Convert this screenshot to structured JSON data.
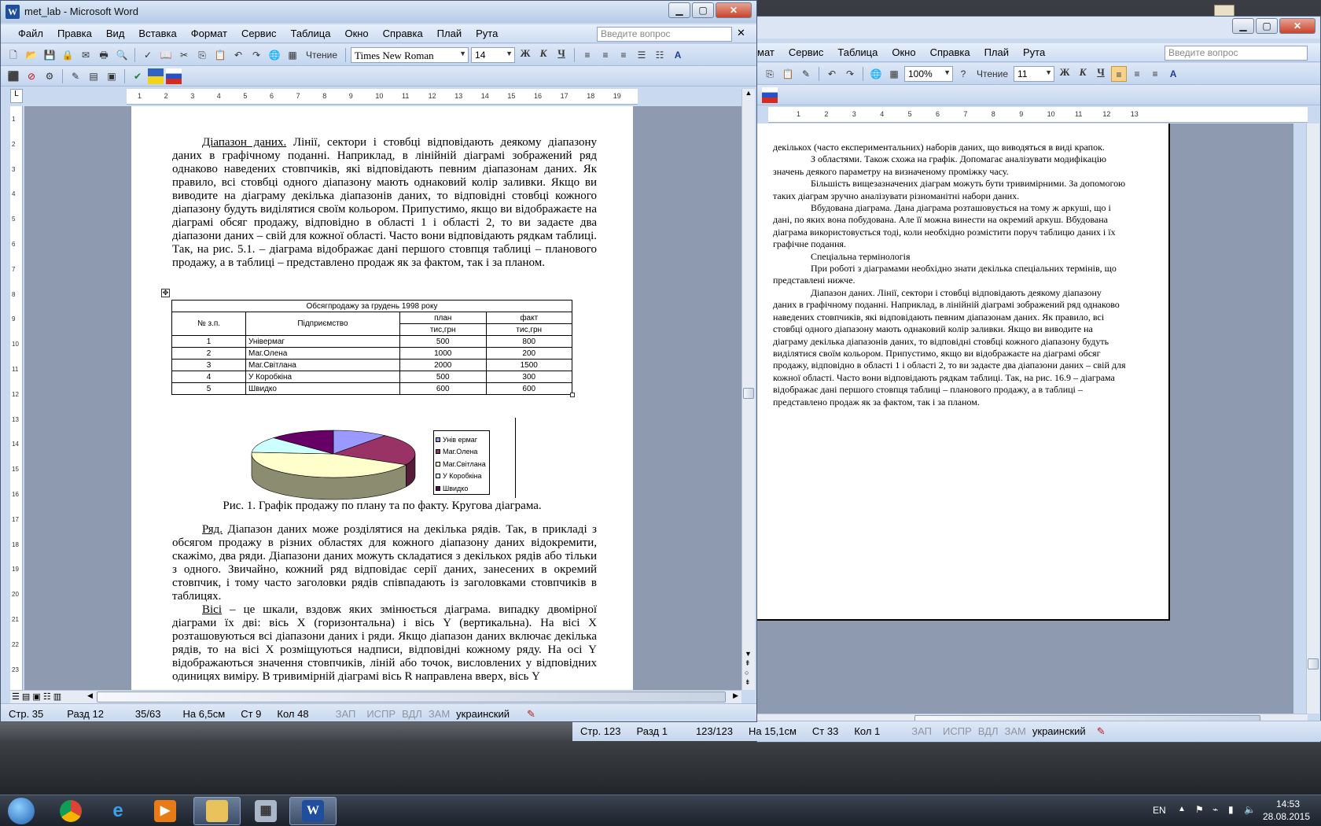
{
  "win1": {
    "title": "met_lab - Microsoft Word",
    "menu": [
      "Файл",
      "Правка",
      "Вид",
      "Вставка",
      "Формат",
      "Сервис",
      "Таблица",
      "Окно",
      "Справка",
      "Плай",
      "Рута"
    ],
    "ask_placeholder": "Введите вопрос",
    "reading_label": "Чтение",
    "font": "Times New Roman",
    "size": "14",
    "fmt": {
      "bold": "Ж",
      "italic": "К",
      "underline": "Ч"
    },
    "ruler_marks": [
      "1",
      "2",
      "3",
      "4",
      "5",
      "6",
      "7",
      "8",
      "9",
      "10",
      "11",
      "12",
      "13",
      "14",
      "15",
      "16",
      "17",
      "18",
      "19"
    ],
    "vruler_marks": [
      "1",
      "2",
      "3",
      "4",
      "5",
      "6",
      "7",
      "8",
      "9",
      "10",
      "11",
      "12",
      "13",
      "14",
      "15",
      "16",
      "17",
      "18",
      "19",
      "20",
      "21",
      "22",
      "23"
    ],
    "para1_head": "Діапазон даних.",
    "para1": " Лінії, сектори і стовбці відповідають деякому діапазону даних в графічному поданні. Наприклад, в лінійній діаграмі зображений ряд однаково наведених стовпчиків, які відповідають певним діапазонам даних. Як правило, всі стовбці одного діапазону мають однаковий колір заливки. Якщо ви виводите на діаграму декілька діапазонів даних, то відповідні стовбці кожного діапазону будуть виділятися своїм кольором. Припустимо, якщо ви відображаєте на діаграмі обсяг продажу, відповідно в області 1 і області 2, то ви задаєте два діапазони даних – свій для кожної області. Часто вони відповідають рядкам таблиці. Так, на рис. 5.1. – діаграма відображає дані першого стовпця таблиці – планового продажу, а в таблиці – представлено продаж як за фактом, так і за планом.",
    "table": {
      "title": "Обсягпродажу за грудень 1998 року",
      "col_num": "№ з.п.",
      "col_company": "Підприємство",
      "col_plan": "план",
      "col_fact": "факт",
      "unit": "тис,грн",
      "rows": [
        [
          "1",
          "Універмаг",
          "500",
          "800"
        ],
        [
          "2",
          "Маг.Олена",
          "1000",
          "200"
        ],
        [
          "3",
          "Маг.Світлана",
          "2000",
          "1500"
        ],
        [
          "4",
          "У Коробкіна",
          "500",
          "300"
        ],
        [
          "5",
          "Швидко",
          "600",
          "600"
        ]
      ]
    },
    "caption": "Рис. 1. Графік продажу по плану та по факту. Кругова діаграма.",
    "para2_head": "Ряд.",
    "para2": " Діапазон даних може розділятися на декілька рядів. Так, в прикладі з обсягом продажу в різних областях для кожного діапазону даних відокремити, скажімо, два ряди. Діапазони даних можуть складатися з декількох рядів або тільки з одного. Звичайно, кожний ряд відповідає серії даних, занесених в окремий стовпчик, і тому часто заголовки рядів співпадають із заголовками стовпчиків в таблицях.",
    "para3_head": "Вісі",
    "para3": " – це шкали, вздовж яких змінюється діаграма.  випадку двомірної діаграми їх дві: вісь X (горизонтальна) і вісь Y (вертикальна). На вісі X розташовуються всі діапазони даних і ряди. Якщо діапазон даних включає декілька рядів, то на вісі X розміщуються надписи, відповідні кожному ряду. На осі Y відображаються значення стовпчиків, ліній або точок, висловлених у відповідних одиницях виміру. В тривимірній діаграмі вісь R направлена вверх, вісь Y",
    "status": {
      "page": "Стр. 35",
      "section": "Разд 12",
      "pages": "35/63",
      "at": "На 6,5см",
      "line": "Ст 9",
      "col": "Кол 48",
      "rec": "ЗАП",
      "trk": "ИСПР",
      "ext": "ВДЛ",
      "ovr": "ЗАМ",
      "lang": "украинский"
    }
  },
  "chart_data": {
    "type": "pie",
    "labels": [
      "Універмаг",
      "Маг.Олена",
      "Маг.Світлана",
      "У Коробкіна",
      "Швидко"
    ],
    "values": [
      500,
      1000,
      2000,
      500,
      600
    ],
    "colors": [
      "#9999ff",
      "#993366",
      "#ffffcc",
      "#ccffff",
      "#660066"
    ],
    "legend_position": "right",
    "legend": [
      "Унів ермаг",
      "Маг.Олена",
      "Маг.Світлана",
      "У Коробкіна",
      "Швидко"
    ]
  },
  "win2": {
    "menu": [
      "мат",
      "Сервис",
      "Таблица",
      "Окно",
      "Справка",
      "Плай",
      "Рута"
    ],
    "ask_placeholder": "Введите вопрос",
    "zoom": "100%",
    "reading_label": "Чтение",
    "size": "11",
    "ruler_marks": [
      "1",
      "2",
      "3",
      "4",
      "5",
      "6",
      "7",
      "8",
      "9",
      "10",
      "11",
      "12",
      "13"
    ],
    "paragraphs": [
      {
        "text": "декількох (часто експериментальних) наборів даних, що виводяться в виді крапок.",
        "indent": false
      },
      {
        "text": "З областями. Також схожа на графік. Допомагає аналізувати модифікацію значень деякого параметру на визначеному проміжку часу.",
        "indent": true
      },
      {
        "text": "Більшість вищезазначених діаграм можуть бути тривимірними. За допомогою таких діаграм зручно аналізувати різноманітні набори даних.",
        "indent": true
      },
      {
        "text": "Вбудована діаграма. Дана діаграма розташовується на тому ж аркуші, що і дані, по яких вона побудована. Але її можна винести на окремий аркуш. Вбудована діаграма використовується тоді, коли необхідно розмістити поруч таблицю даних і їх графічне подання.",
        "indent": true
      },
      {
        "text": "Спеціальна термінологія",
        "indent": true
      },
      {
        "text": "При роботі з діаграмами необхідно знати декілька спеціальних термінів, що представлені нижче.",
        "indent": true
      },
      {
        "text": "Діапазон даних. Лінії, сектори і стовбці відповідають деякому діапазону даних в графічному поданні. Наприклад, в лінійній діаграмі зображений ряд однаково наведених стовпчиків, які відповідають певним діапазонам даних. Як правило, всі стовбці одного діапазону мають однаковий колір заливки. Якщо ви виводите на діаграму декілька діапазонів даних, то відповідні стовбці кожного діапазону будуть виділятися своїм кольором. Припустимо, якщо ви відображаєте на діаграмі обсяг продажу, відповідно в області 1 і області 2, то ви задаєте два діапазони даних – свій для кожної області. Часто вони відповідають рядкам таблиці. Так, на рис. 16.9 – діаграма відображає дані першого стовпця таблиці – планового продажу, а в таблиці – представлено продаж як за фактом, так і за планом.",
        "indent": true
      }
    ],
    "status": {
      "page": "Стр. 123",
      "section": "Разд 1",
      "pages": "123/123",
      "at": "На 15,1см",
      "line": "Ст 33",
      "col": "Кол 1",
      "rec": "ЗАП",
      "trk": "ИСПР",
      "ext": "ВДЛ",
      "ovr": "ЗАМ",
      "lang": "украинский"
    }
  },
  "taskbar": {
    "lang": "EN",
    "time": "14:53",
    "date": "28.08.2015"
  }
}
